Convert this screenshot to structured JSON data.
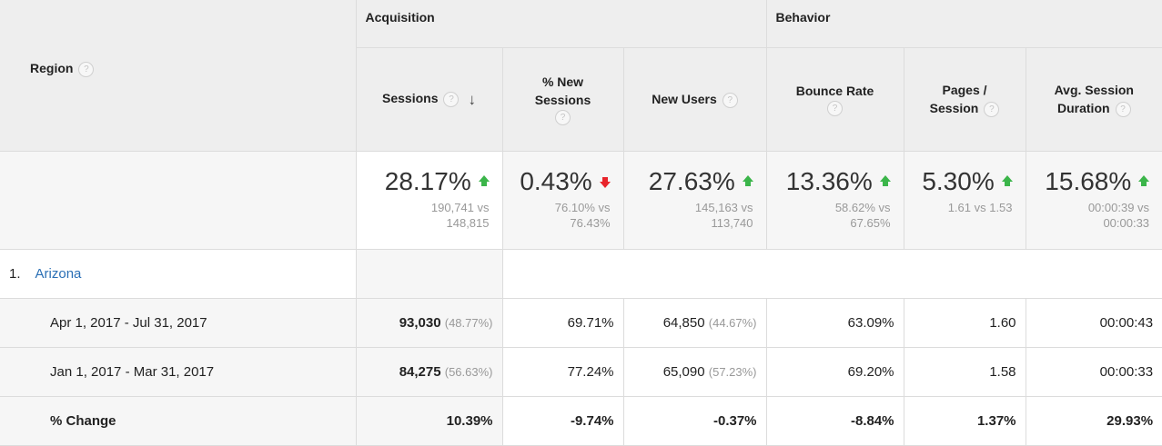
{
  "header": {
    "region_label": "Region",
    "groups": {
      "acquisition": "Acquisition",
      "behavior": "Behavior"
    },
    "columns": {
      "sessions": "Sessions",
      "new_sessions_line1": "% New",
      "new_sessions_line2": "Sessions",
      "new_users": "New Users",
      "bounce_rate": "Bounce Rate",
      "pages_line1": "Pages /",
      "pages_line2": "Session",
      "duration_line1": "Avg. Session",
      "duration_line2": "Duration"
    },
    "help_glyph": "?",
    "sort_glyph": "↓"
  },
  "summary": {
    "sessions": {
      "value": "28.17%",
      "trend": "up",
      "line1": "190,741 vs",
      "line2": "148,815"
    },
    "new_sessions": {
      "value": "0.43%",
      "trend": "down",
      "line1": "76.10% vs",
      "line2": "76.43%"
    },
    "new_users": {
      "value": "27.63%",
      "trend": "up",
      "line1": "145,163 vs",
      "line2": "113,740"
    },
    "bounce_rate": {
      "value": "13.36%",
      "trend": "up",
      "line1": "58.62% vs",
      "line2": "67.65%"
    },
    "pages": {
      "value": "5.30%",
      "trend": "up",
      "line1": "1.61 vs 1.53",
      "line2": ""
    },
    "duration": {
      "value": "15.68%",
      "trend": "up",
      "line1": "00:00:39 vs",
      "line2": "00:00:33"
    }
  },
  "region": {
    "index": "1.",
    "name": "Arizona"
  },
  "rows": [
    {
      "label": "Apr 1, 2017 - Jul 31, 2017",
      "sessions": "93,030",
      "sessions_pct": "(48.77%)",
      "new_sessions": "69.71%",
      "new_users": "64,850",
      "new_users_pct": "(44.67%)",
      "bounce_rate": "63.09%",
      "pages": "1.60",
      "duration": "00:00:43"
    },
    {
      "label": "Jan 1, 2017 - Mar 31, 2017",
      "sessions": "84,275",
      "sessions_pct": "(56.63%)",
      "new_sessions": "77.24%",
      "new_users": "65,090",
      "new_users_pct": "(57.23%)",
      "bounce_rate": "69.20%",
      "pages": "1.58",
      "duration": "00:00:33"
    }
  ],
  "change": {
    "label": "% Change",
    "sessions": "10.39%",
    "new_sessions": "-9.74%",
    "new_users": "-0.37%",
    "bounce_rate": "-8.84%",
    "pages": "1.37%",
    "duration": "29.93%"
  },
  "colors": {
    "link": "#2a6fb5",
    "up": "#3bb54a",
    "down": "#e8242b",
    "header_bg": "#eeeeee"
  }
}
